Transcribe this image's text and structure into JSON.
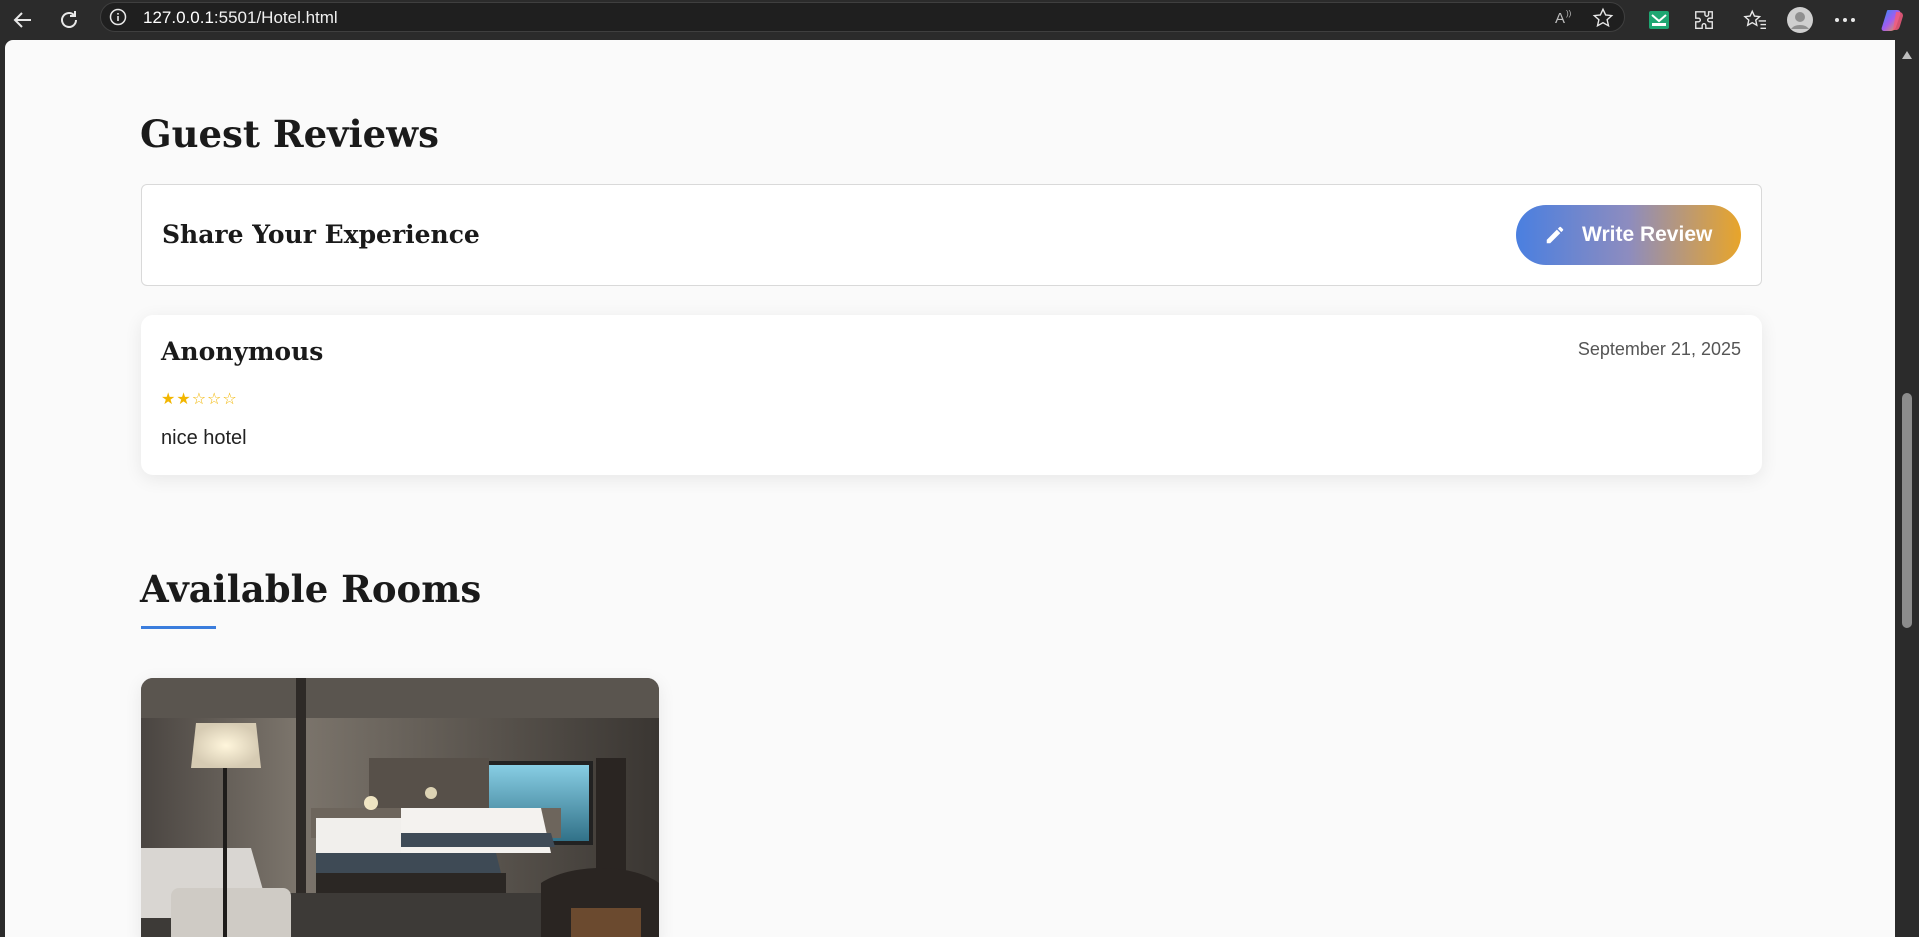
{
  "browser": {
    "url_host": "127.0.0.1",
    "url_rest": ":5501/Hotel.html"
  },
  "reviews": {
    "title": "Guest Reviews",
    "share_title": "Share Your Experience",
    "write_button_label": "Write Review",
    "items": [
      {
        "author": "Anonymous",
        "date": "September 21, 2025",
        "rating": 2,
        "rating_stars": "★★☆☆☆",
        "text": "nice hotel"
      }
    ]
  },
  "rooms": {
    "title": "Available Rooms"
  },
  "colors": {
    "accent_blue": "#3b7ddd",
    "button_gradient_start": "#4a7fe0",
    "button_gradient_end": "#e8a52a",
    "star": "#f2b600"
  },
  "icons": [
    "back-icon",
    "reload-icon",
    "info-icon",
    "read-aloud-icon",
    "favorite-star-icon",
    "mail-extension-icon",
    "extensions-icon",
    "favorites-icon",
    "profile-icon",
    "more-icon",
    "copilot-icon",
    "pencil-icon"
  ]
}
